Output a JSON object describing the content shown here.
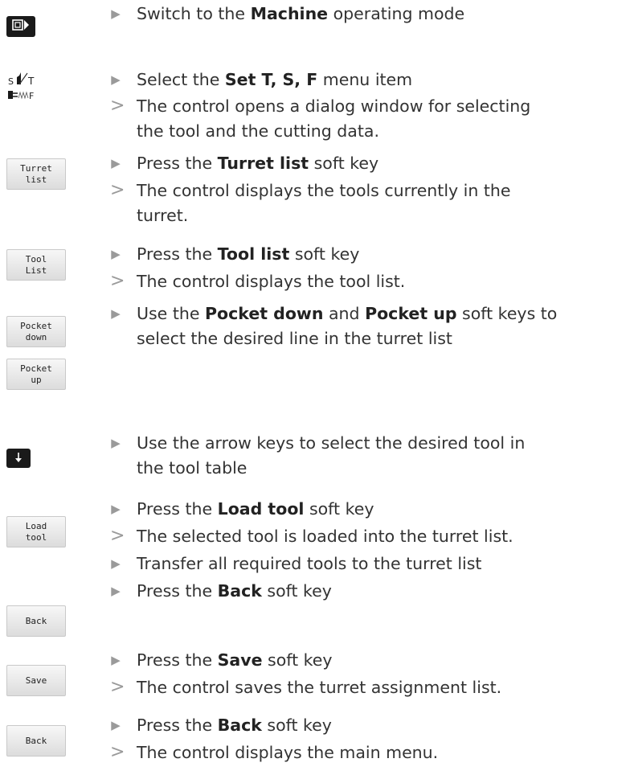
{
  "keys": {
    "turret_list": "Turret\nlist",
    "tool_list": "Tool\nList",
    "pocket_down": "Pocket\ndown",
    "pocket_up": "Pocket\nup",
    "load_tool": "Load\ntool",
    "back": "Back",
    "save": "Save",
    "back2": "Back"
  },
  "icons": {
    "machine": "machine-mode-icon",
    "set_tsf": "set-tsf-icon",
    "arrow_down": "arrow-down-key-icon",
    "set_tsf_s": "S",
    "set_tsf_t": "T",
    "set_tsf_f": "F"
  },
  "steps": [
    {
      "pre": "Switch to the ",
      "b1": "Machine",
      "post": " operating mode"
    },
    {
      "pre": "Select the ",
      "b1": "Set T, S, F",
      "post": " menu item"
    },
    {
      "text": "The control opens a dialog window for selecting"
    },
    {
      "text": "the tool and the cutting data."
    },
    {
      "pre": "Press the ",
      "b1": "Turret list",
      "post": " soft key"
    },
    {
      "text": "The control displays the tools currently in the"
    },
    {
      "text": "turret."
    },
    {
      "pre": "Press the ",
      "b1": "Tool list",
      "post": " soft key"
    },
    {
      "text": "The control displays the tool list."
    },
    {
      "pre": "Use the ",
      "b1": "Pocket down",
      "mid": " and ",
      "b2": "Pocket up",
      "post": " soft keys to"
    },
    {
      "text": "select the desired line in the turret list"
    },
    {
      "text": "Use the arrow keys to select the desired tool in"
    },
    {
      "text": "the tool table"
    },
    {
      "pre": "Press the ",
      "b1": "Load tool",
      "post": " soft key"
    },
    {
      "text": "The selected tool is loaded into the turret list."
    },
    {
      "text": "Transfer all required tools to the turret list"
    },
    {
      "pre": "Press the ",
      "b1": "Back",
      "post": " soft key"
    },
    {
      "pre": "Press the ",
      "b1": "Save",
      "post": " soft key"
    },
    {
      "text": "The control saves the turret assignment list."
    },
    {
      "pre": "Press the ",
      "b1": "Back",
      "post": " soft key"
    },
    {
      "text": "The control displays the main menu."
    }
  ]
}
